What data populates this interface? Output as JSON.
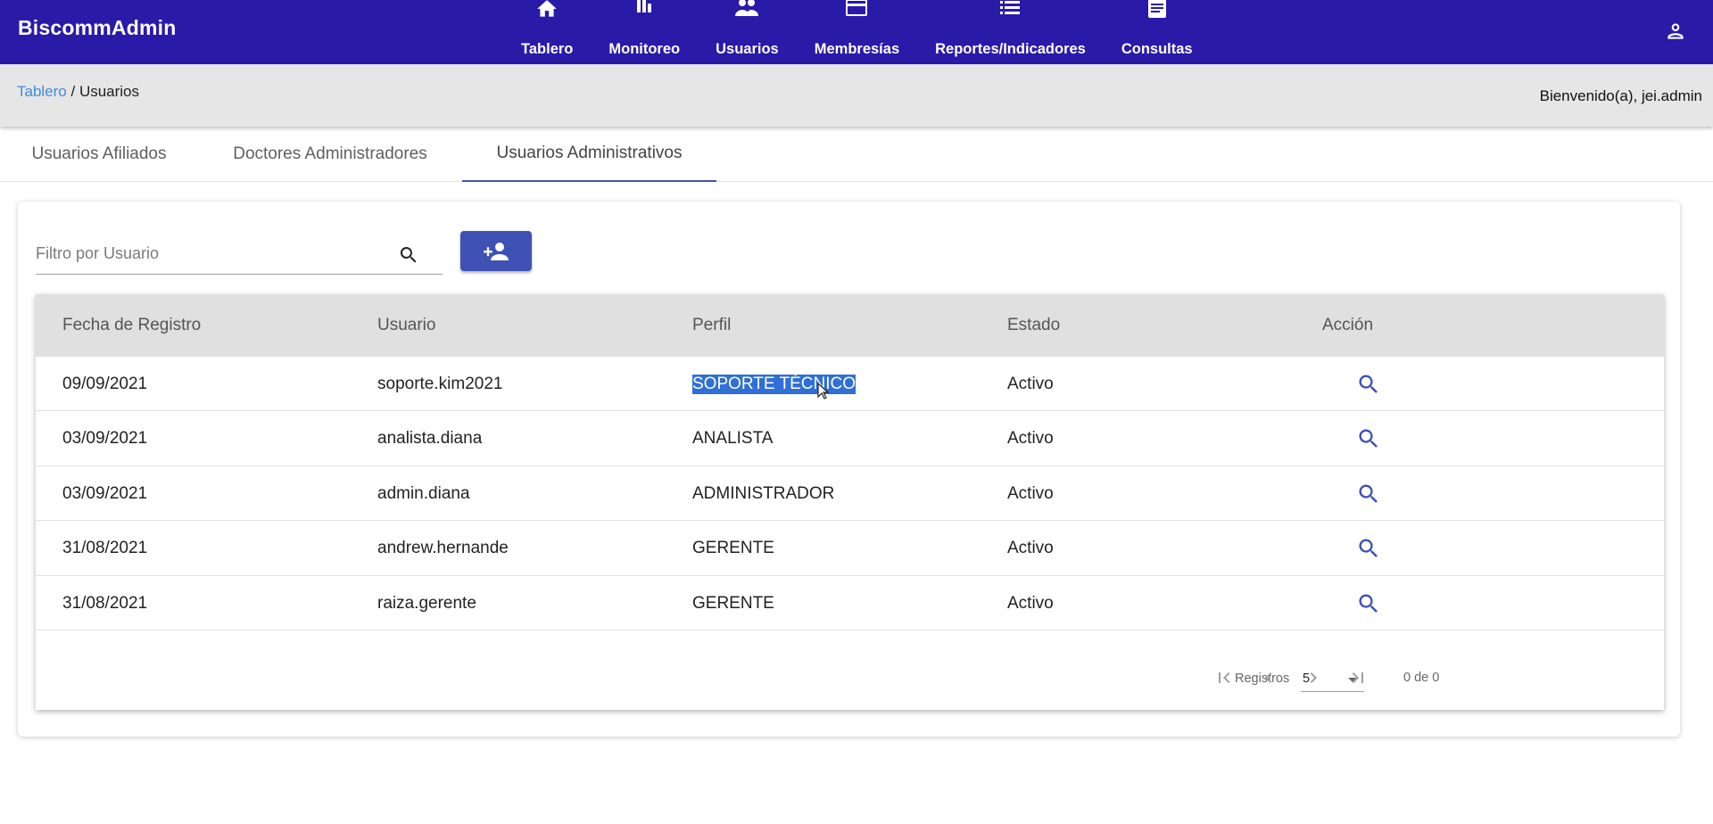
{
  "app": {
    "title": "BiscommAdmin"
  },
  "nav": {
    "items": [
      {
        "label": "Tablero",
        "icon": "home-icon"
      },
      {
        "label": "Monitoreo",
        "icon": "bar-chart-icon"
      },
      {
        "label": "Usuarios",
        "icon": "people-icon"
      },
      {
        "label": "Membresías",
        "icon": "credit-card-icon"
      },
      {
        "label": "Reportes/Indicadores",
        "icon": "list-icon"
      },
      {
        "label": "Consultas",
        "icon": "article-icon"
      }
    ],
    "user_icon": "account-icon"
  },
  "breadcrumb": {
    "link": "Tablero",
    "separator": " / ",
    "current": "Usuarios"
  },
  "welcome": "Bienvenido(a), jei.admin",
  "tabs": [
    {
      "label": "Usuarios Afiliados"
    },
    {
      "label": "Doctores Administradores"
    },
    {
      "label": "Usuarios Administrativos",
      "active": true
    }
  ],
  "filter": {
    "placeholder": "Filtro por Usuario",
    "value": "",
    "icon": "search-icon"
  },
  "add_button": {
    "icon": "person-add-icon"
  },
  "table": {
    "headers": [
      "Fecha de Registro",
      "Usuario",
      "Perfil",
      "Estado",
      "Acción"
    ],
    "rows": [
      {
        "fecha": "09/09/2021",
        "usuario": "soporte.kim2021",
        "perfil": "SOPORTE TÉCNICO",
        "estado": "Activo"
      },
      {
        "fecha": "03/09/2021",
        "usuario": "analista.diana",
        "perfil": "ANALISTA",
        "estado": "Activo"
      },
      {
        "fecha": "03/09/2021",
        "usuario": "admin.diana",
        "perfil": "ADMINISTRADOR",
        "estado": "Activo"
      },
      {
        "fecha": "31/08/2021",
        "usuario": "andrew.hernande",
        "perfil": "GERENTE",
        "estado": "Activo"
      },
      {
        "fecha": "31/08/2021",
        "usuario": "raiza.gerente",
        "perfil": "GERENTE",
        "estado": "Activo"
      }
    ],
    "action_icon": "search-icon"
  },
  "paginator": {
    "label": "Registros",
    "page_size": "5",
    "range": "0 de 0"
  },
  "colors": {
    "topbar": "#2a1aa8",
    "accent": "#3f51b5",
    "link": "#3f8be0",
    "selection": "#2f6fd6"
  }
}
